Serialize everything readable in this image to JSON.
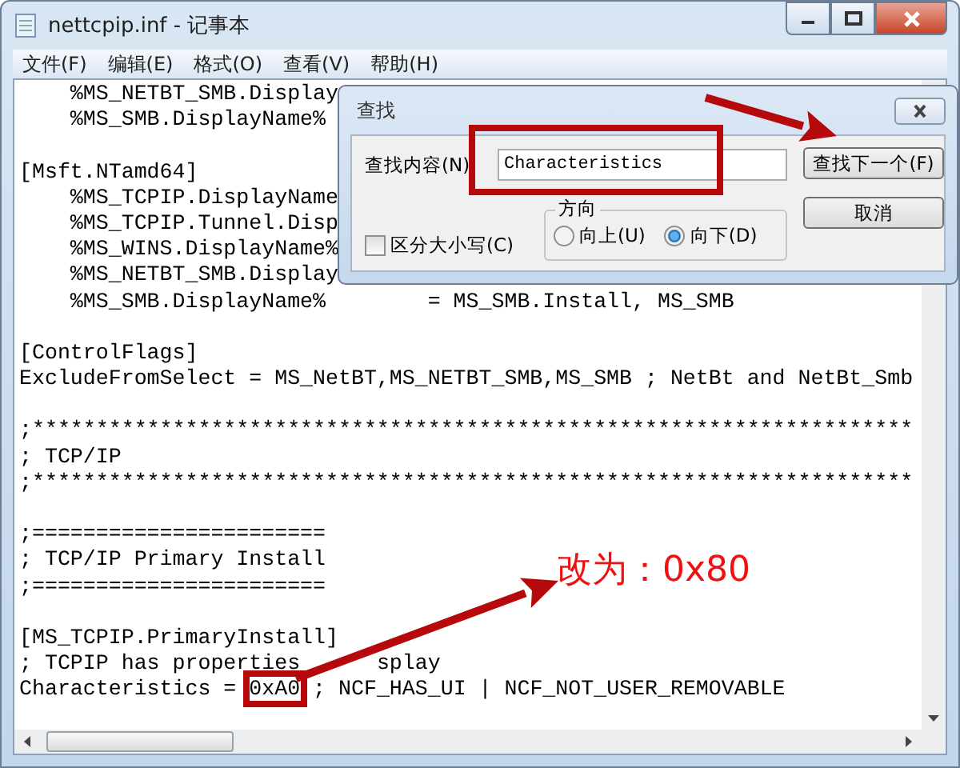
{
  "window": {
    "title": "nettcpip.inf - 记事本"
  },
  "menu": [
    "文件(F)",
    "编辑(E)",
    "格式(O)",
    "查看(V)",
    "帮助(H)"
  ],
  "editor": {
    "lines": [
      {
        "kind": "code",
        "text": "    %MS_NETBT_SMB.Display"
      },
      {
        "kind": "code",
        "text": "    %MS_SMB.DisplayName%"
      },
      {
        "kind": "blank"
      },
      {
        "kind": "code",
        "text": "[Msft.NTamd64]"
      },
      {
        "kind": "code",
        "text": "    %MS_TCPIP.DisplayName"
      },
      {
        "kind": "code",
        "text": "    %MS_TCPIP.Tunnel.Disp"
      },
      {
        "kind": "code",
        "text": "    %MS_WINS.DisplayName%"
      },
      {
        "kind": "code",
        "text": "    %MS_NETBT_SMB.Display"
      },
      {
        "kind": "code",
        "text": "    %MS_SMB.DisplayName%        = MS_SMB.Install, MS_SMB"
      },
      {
        "kind": "blank"
      },
      {
        "kind": "code",
        "text": "[ControlFlags]"
      },
      {
        "kind": "code",
        "text": "ExcludeFromSelect = MS_NetBT,MS_NETBT_SMB,MS_SMB ; NetBt and NetBt_Smb"
      },
      {
        "kind": "blank"
      },
      {
        "kind": "code",
        "text": ";*********************************************************************"
      },
      {
        "kind": "code",
        "text": "; TCP/IP"
      },
      {
        "kind": "code",
        "text": ";*********************************************************************"
      },
      {
        "kind": "blank"
      },
      {
        "kind": "code",
        "text": ";======================="
      },
      {
        "kind": "code",
        "text": "; TCP/IP Primary Install"
      },
      {
        "kind": "code",
        "text": ";======================="
      },
      {
        "kind": "blank"
      },
      {
        "kind": "code",
        "text": "[MS_TCPIP.PrimaryInstall]"
      },
      {
        "kind": "split",
        "text": "; TCPIP has properties",
        "after": "splay"
      },
      {
        "kind": "marked",
        "text": "Characteristics = ",
        "marked": "0xA0",
        "after": " ; NCF_HAS_UI | NCF_NOT_USER_REMOVABLE"
      }
    ]
  },
  "find_dialog": {
    "title": "查找",
    "find_label": "查找内容(N)",
    "find_value": "Characteristics",
    "find_next": "查找下一个(F)",
    "cancel": "取消",
    "match_case": {
      "label": "区分大小写(C)",
      "checked": false
    },
    "direction": {
      "label": "方向",
      "options": [
        {
          "label": "向上(U)",
          "selected": false
        },
        {
          "label": "向下(D)",
          "selected": true
        }
      ]
    }
  },
  "annotation": {
    "note": "改为：0x80"
  }
}
